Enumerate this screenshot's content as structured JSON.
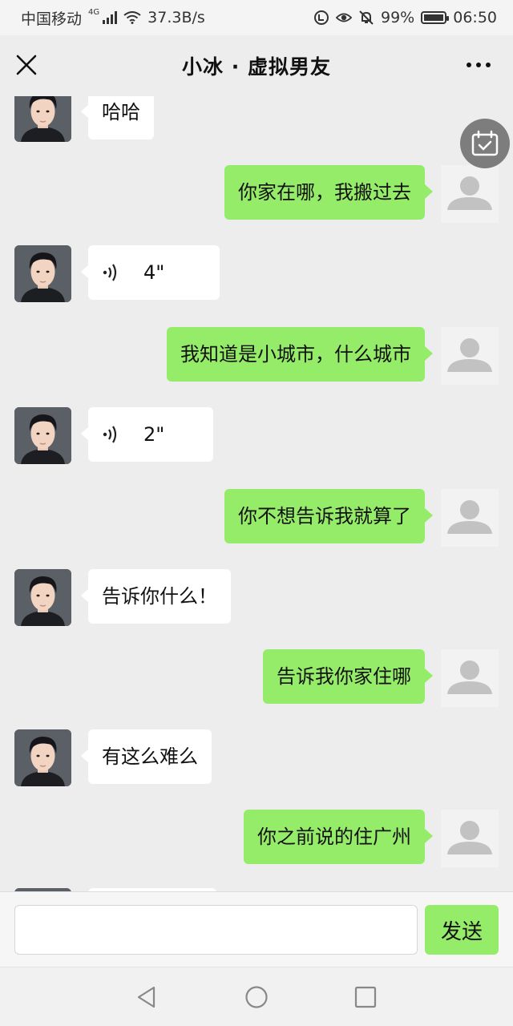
{
  "status_bar": {
    "carrier": "中国移动",
    "network_type": "4G",
    "net_speed": "37.3B/s",
    "battery": "99%",
    "time": "06:50"
  },
  "header": {
    "title": "小冰 · 虚拟男友",
    "close_icon": "close-icon",
    "more_icon": "more-dots-icon"
  },
  "messages": [
    {
      "side": "left",
      "text": "哈哈"
    },
    {
      "side": "right",
      "text": "你家在哪，我搬过去"
    },
    {
      "side": "left",
      "type": "voice",
      "duration": "4\""
    },
    {
      "side": "right",
      "text": "我知道是小城市，什么城市"
    },
    {
      "side": "left",
      "type": "voice",
      "duration": "2\""
    },
    {
      "side": "right",
      "text": "你不想告诉我就算了"
    },
    {
      "side": "left",
      "text": "告诉你什么！"
    },
    {
      "side": "right",
      "text": "告诉我你家住哪"
    },
    {
      "side": "left",
      "text": "有这么难么"
    },
    {
      "side": "right",
      "text": "你之前说的住广州"
    }
  ],
  "composer": {
    "input_value": "",
    "send_label": "发送"
  },
  "colors": {
    "background": "#ededed",
    "sent_bubble": "#95ec69",
    "received_bubble": "#ffffff"
  },
  "icons": {
    "floating": "calendar-check-icon",
    "nav": [
      "back-triangle-icon",
      "home-circle-icon",
      "recents-square-icon"
    ]
  }
}
